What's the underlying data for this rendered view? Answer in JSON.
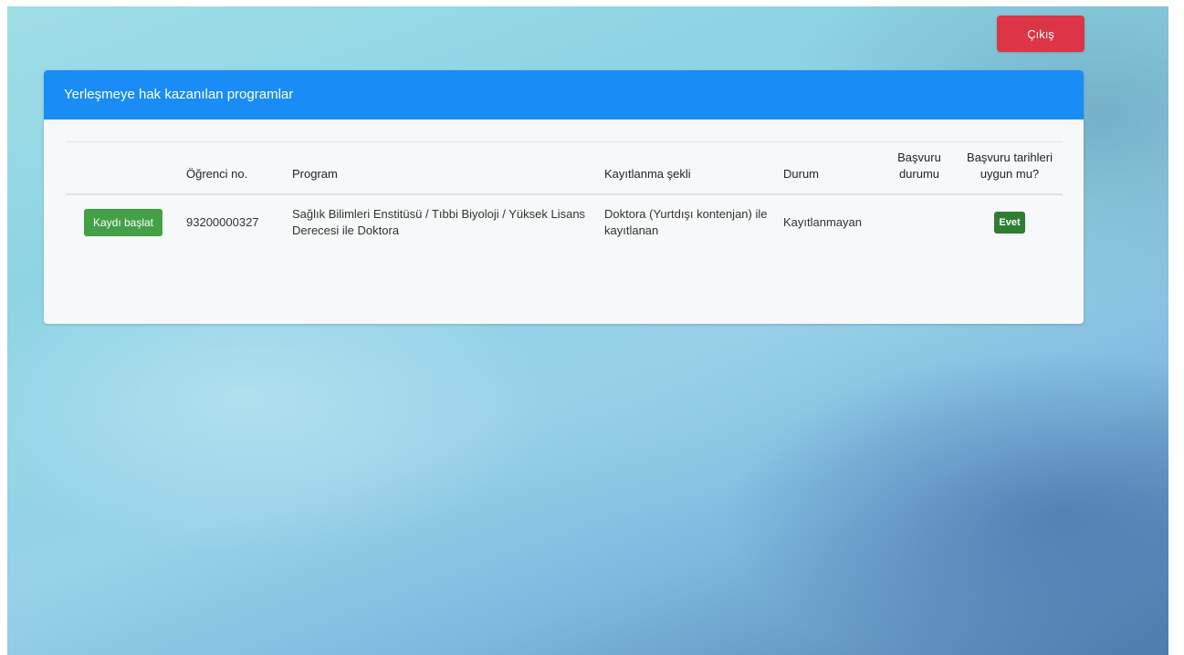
{
  "header": {
    "logout_label": "Çıkış"
  },
  "card": {
    "title": "Yerleşmeye hak kazanılan programlar"
  },
  "table": {
    "columns": [
      "",
      "Öğrenci no.",
      "Program",
      "Kayıtlanma şekli",
      "Durum",
      "Başvuru durumu",
      "Başvuru tarihleri uygun mu?"
    ],
    "rows": [
      {
        "action_label": "Kaydı başlat",
        "student_no": "93200000327",
        "program": "Sağlık Bilimleri Enstitüsü / Tıbbi Biyoloji / Yüksek Lisans Derecesi ile Doktora",
        "registration_type": "Doktora (Yurtdışı kontenjan) ile kayıtlanan",
        "status": "Kayıtlanmayan",
        "application_status": "",
        "dates_ok": "Evet"
      }
    ]
  },
  "colors": {
    "header_blue": "#1a8cf5",
    "logout_red": "#dc3545",
    "start_green": "#43a047",
    "badge_green": "#2e7d32"
  }
}
